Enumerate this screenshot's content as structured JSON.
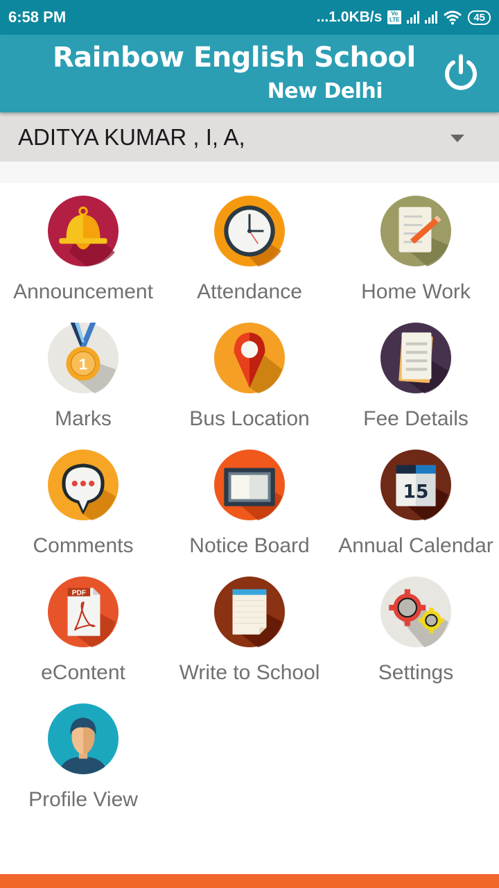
{
  "status_bar": {
    "time": "6:58 PM",
    "network_speed": "...1.0KB/s",
    "volte_top": "Vo",
    "volte_bottom": "LTE",
    "battery": "45"
  },
  "header": {
    "school_name": "Rainbow English School",
    "school_city": "New Delhi",
    "power_icon": "power-icon"
  },
  "student_selector": {
    "selected": "ADITYA KUMAR  , I, A,"
  },
  "colors": {
    "status_bar": "#0c879e",
    "header": "#2b9eb3",
    "selector_bg": "#e2dede",
    "bottom_bar": "#f1662a",
    "label_text": "#707070"
  },
  "menu": {
    "items": [
      {
        "label": "Announcement",
        "icon": "bell-icon"
      },
      {
        "label": "Attendance",
        "icon": "clock-icon"
      },
      {
        "label": "Home Work",
        "icon": "homework-icon"
      },
      {
        "label": "Marks",
        "icon": "medal-icon"
      },
      {
        "label": "Bus Location",
        "icon": "location-pin-icon"
      },
      {
        "label": "Fee Details",
        "icon": "notepad-icon"
      },
      {
        "label": "Comments",
        "icon": "chat-bubble-icon"
      },
      {
        "label": "Notice Board",
        "icon": "board-icon"
      },
      {
        "label": "Annual Calendar",
        "icon": "calendar-icon",
        "badge": "15"
      },
      {
        "label": "eContent",
        "icon": "pdf-icon",
        "badge": "PDF"
      },
      {
        "label": "Write to School",
        "icon": "note-icon"
      },
      {
        "label": "Settings",
        "icon": "gears-icon"
      },
      {
        "label": "Profile View",
        "icon": "profile-icon"
      }
    ]
  }
}
